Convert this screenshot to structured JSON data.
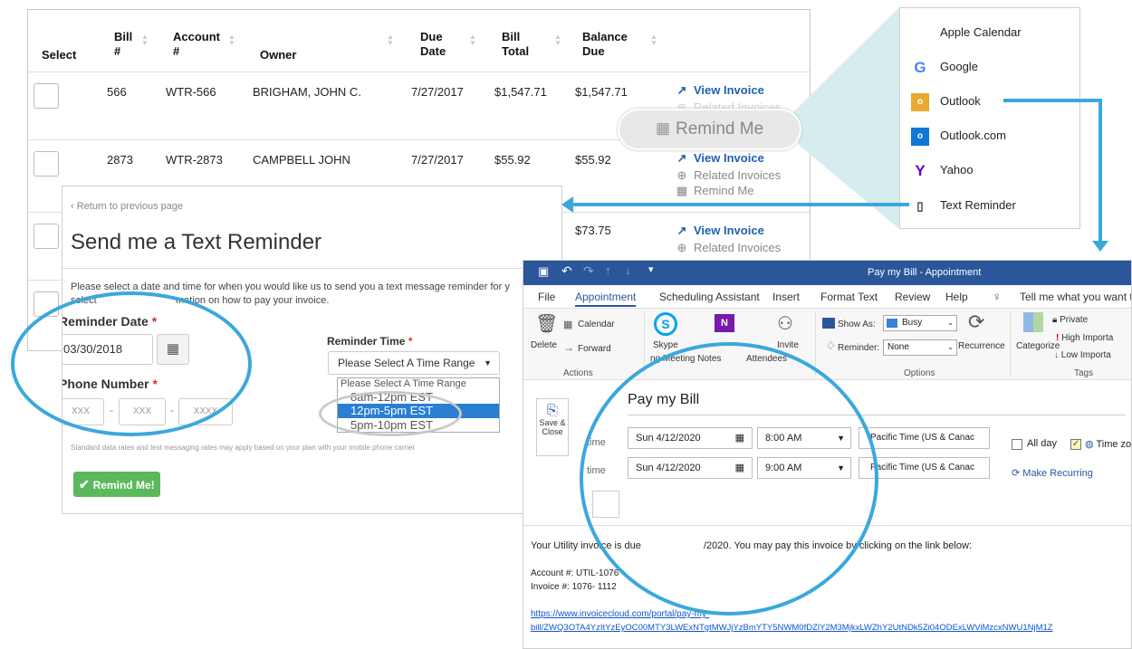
{
  "bills": {
    "headers": [
      "Select",
      "Bill #",
      "Account #",
      "Owner",
      "Due Date",
      "Bill Total",
      "Balance Due"
    ],
    "rows": [
      {
        "bill": "566",
        "account": "WTR-566",
        "owner": "BRIGHAM, JOHN C.",
        "due": "7/27/2017",
        "total": "$1,547.71",
        "balance": "$1,547.71"
      },
      {
        "bill": "2873",
        "account": "WTR-2873",
        "owner": "CAMPBELL JOHN",
        "due": "7/27/2017",
        "total": "$55.92",
        "balance": "$55.92"
      },
      {
        "balance": "$73.75"
      }
    ],
    "view_invoice": "View Invoice",
    "related_invoices": "Related Invoices",
    "remind_me": "Remind Me"
  },
  "providers": [
    "Apple Calendar",
    "Google",
    "Outlook",
    "Outlook.com",
    "Yahoo",
    "Text Reminder"
  ],
  "text_reminder": {
    "back_link": "Return to previous page",
    "title": "Send me a Text Reminder",
    "intro_line1": "Please select a date and time for when you would like us to send you a text message reminder for y",
    "intro_line2a": "select",
    "intro_line2b": "mation on how to pay your invoice.",
    "date_label": "Reminder Date",
    "date_value": "03/30/2018",
    "time_label": "Reminder Time",
    "time_select": "Please Select A Time Range",
    "time_options": [
      "Please Select A Time Range",
      "8am-12pm EST",
      "12pm-5pm EST",
      "5pm-10pm EST"
    ],
    "selected_option": "12pm-5pm EST",
    "phone_label": "Phone Number",
    "phone_placeholders": [
      "XXX",
      "XXX",
      "XXXX"
    ],
    "phone_sep": "-",
    "fine_print": "Standard data rates and text messaging rates may apply based on your plan with your mobile phone carrier",
    "button": "Remind Me!",
    "required_mark": "*"
  },
  "outlook": {
    "title": "Pay my Bill - Appointment",
    "tabs": [
      "File",
      "Appointment",
      "Scheduling Assistant",
      "Insert",
      "Format Text",
      "Review",
      "Help"
    ],
    "tell_me": "Tell me what you want to",
    "ribbon": {
      "delete": "Delete",
      "calendar": "Calendar",
      "forward": "Forward",
      "actions": "Actions",
      "skype": "Skype",
      "onenote_fragment": "ng Meeting Notes",
      "attendees": "Attendees",
      "invite": "Invite",
      "show_as": "Show As:",
      "busy": "Busy",
      "reminder": "Reminder:",
      "none": "None",
      "recurrence": "Recurrence",
      "options": "Options",
      "categorize": "Categorize",
      "private": "Private",
      "high": "High Importa",
      "low": "Low Importa",
      "tags": "Tags"
    },
    "save_close": [
      "Save &",
      "Close"
    ],
    "subject": "Pay my Bill",
    "start_label": "time",
    "end_label": "time",
    "start_date": "Sun 4/12/2020",
    "start_time": "8:00 AM",
    "end_date": "Sun 4/12/2020",
    "end_time": "9:00 AM",
    "timezone": "Pacific Time (US & Canac",
    "all_day": "All day",
    "time_zones": "Time zon",
    "make_recurring": "Make Recurring",
    "body_line1a": "Your Utility invoice is due",
    "body_line1b": "/2020. You may pay this invoice by clicking on the link below:",
    "account": "Account #: UTIL-1076",
    "invoice": "Invoice #: 1076- 1112",
    "link1": "https://www.invoicecloud.com/portal/pay-my-",
    "link2": "bill/ZWQ3OTA4YzItYzEyOC00MTY3LWExNTgtMWJjYzBmYTY5NWM0fDZlY2M3MjkxLWZhY2UtNDk5Zi04ODExLWViMzcxNWU1NjM1Z"
  },
  "colors": {
    "accent": "#3ba8dc",
    "outlook_blue": "#2b579a",
    "green": "#5cb85c",
    "link": "#1f5fae"
  }
}
